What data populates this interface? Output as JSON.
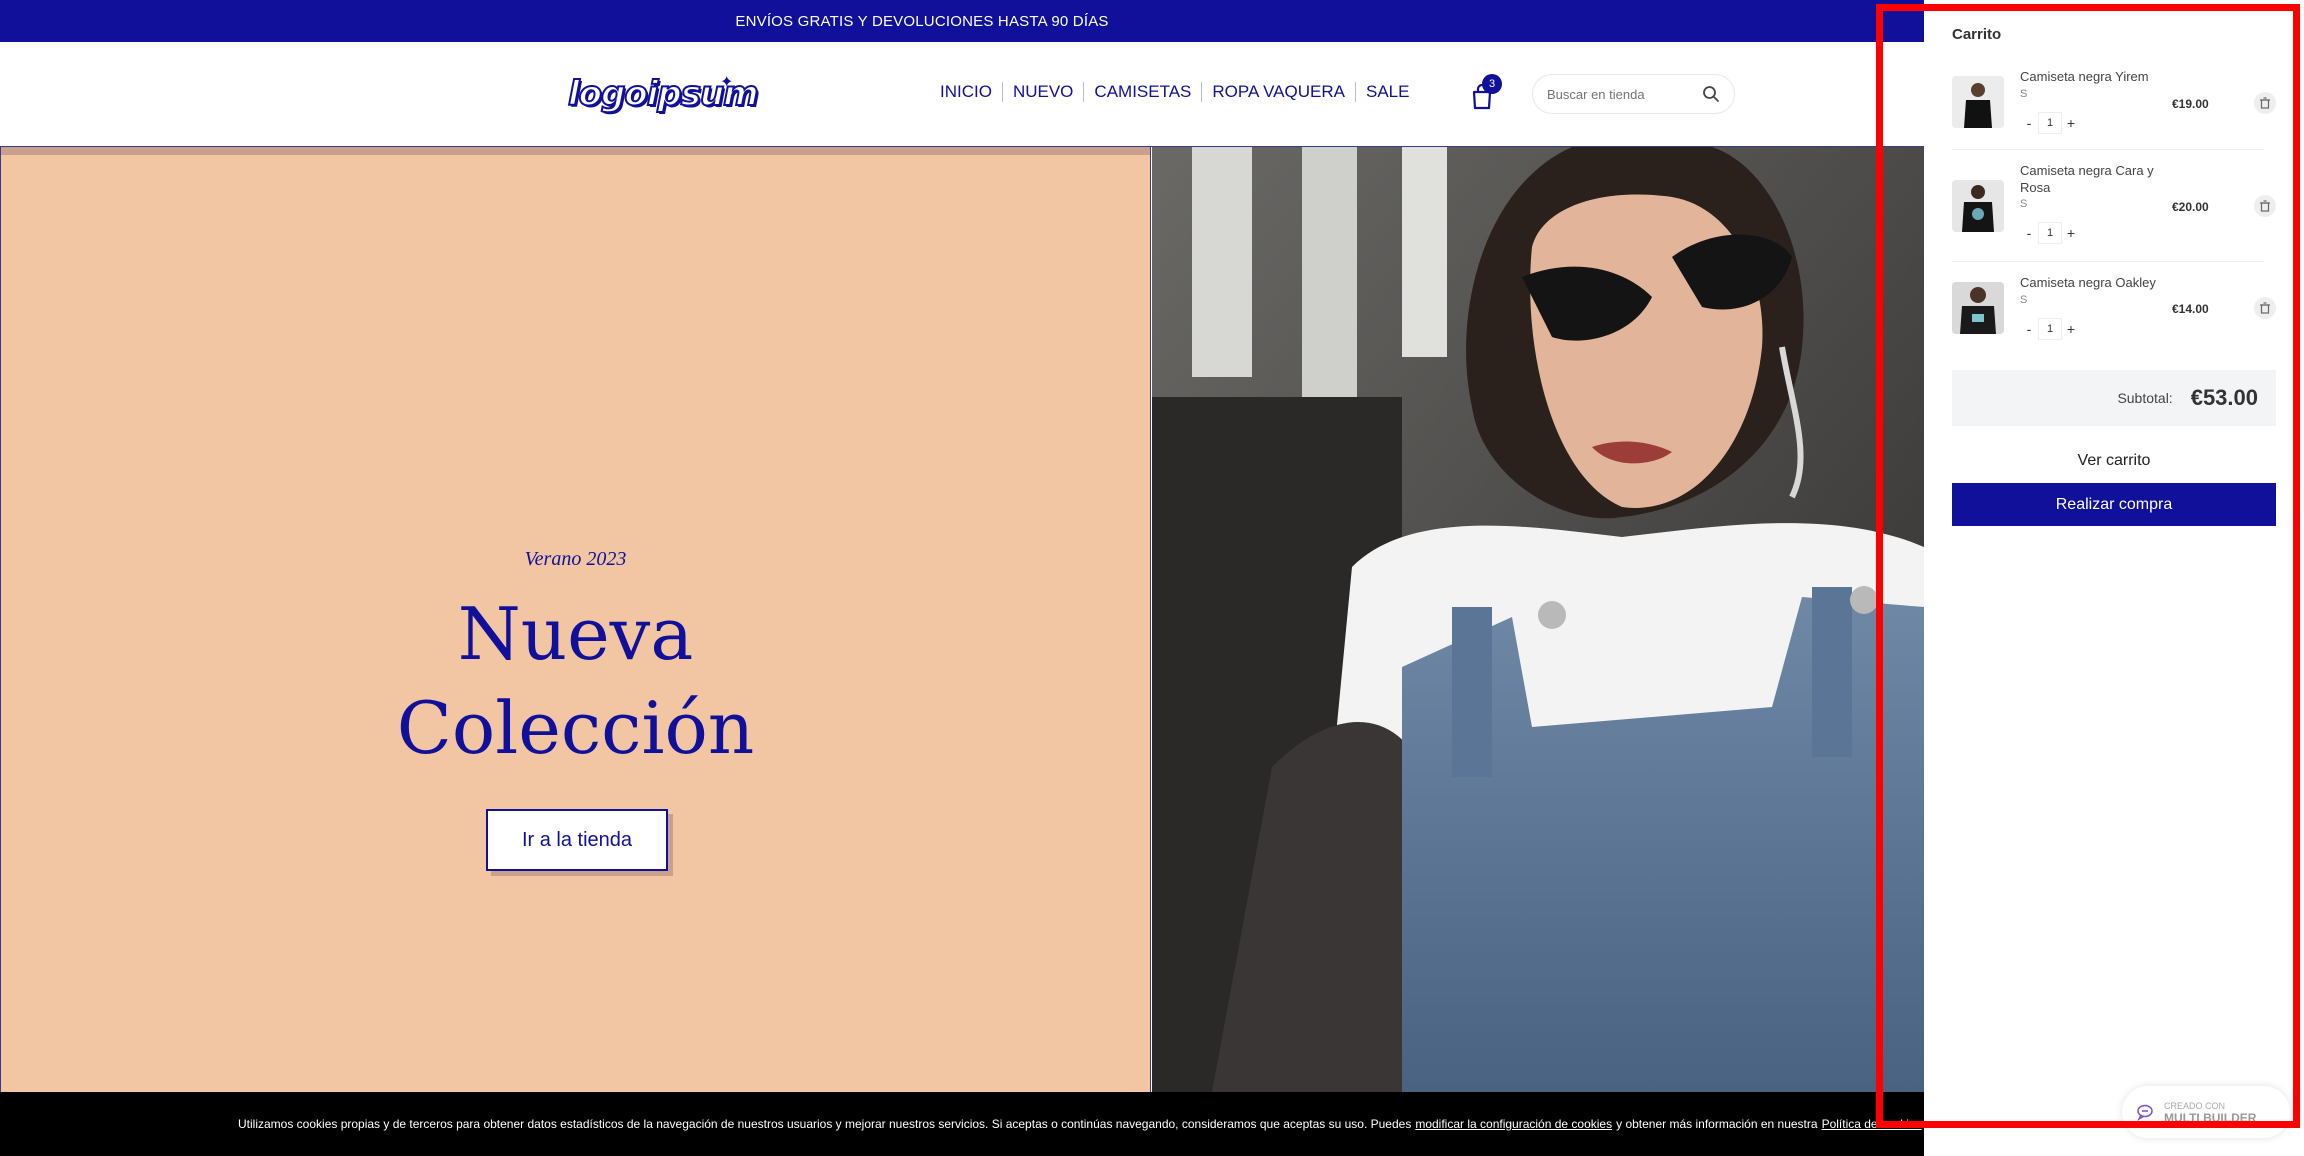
{
  "announcement": {
    "text": "ENVÍOS GRATIS Y DEVOLUCIONES HASTA 90 DÍAS"
  },
  "header": {
    "logo_text": "logoipsum",
    "nav": [
      "INICIO",
      "NUEVO",
      "CAMISETAS",
      "ROPA VAQUERA",
      "SALE"
    ],
    "cart_count": "3",
    "search_placeholder": "Buscar en tienda"
  },
  "hero": {
    "kicker": "Verano 2023",
    "title_line1": "Nueva",
    "title_line2": "Colección",
    "button": "Ir a la tienda"
  },
  "cookie": {
    "text": "Utilizamos cookies propias y de terceros para obtener datos estadísticos de la navegación de nuestros usuarios y mejorar nuestros servicios. Si aceptas o continúas navegando, consideramos que aceptas su uso. Puedes",
    "link1": "modificar la configuración de cookies",
    "text2": "y obtener más información en nuestra",
    "link2": "Política de cookies"
  },
  "cart": {
    "title": "Carrito",
    "items": [
      {
        "name": "Camiseta negra Yirem",
        "size": "S",
        "qty": "1",
        "price": "€19.00",
        "minus": "-",
        "plus": "+"
      },
      {
        "name": "Camiseta negra Cara y Rosa",
        "size": "S",
        "qty": "1",
        "price": "€20.00",
        "minus": "-",
        "plus": "+"
      },
      {
        "name": "Camiseta negra Oakley",
        "size": "S",
        "qty": "1",
        "price": "€14.00",
        "minus": "-",
        "plus": "+"
      }
    ],
    "subtotal_label": "Subtotal:",
    "subtotal_value": "€53.00",
    "view_cart": "Ver carrito",
    "checkout": "Realizar compra"
  },
  "builder": {
    "small": "CREADO CON",
    "big": "MULTI BUILDER"
  },
  "colors": {
    "brand": "#10109a",
    "hero_bg": "#f2c6a3",
    "highlight": "#ff0000"
  }
}
